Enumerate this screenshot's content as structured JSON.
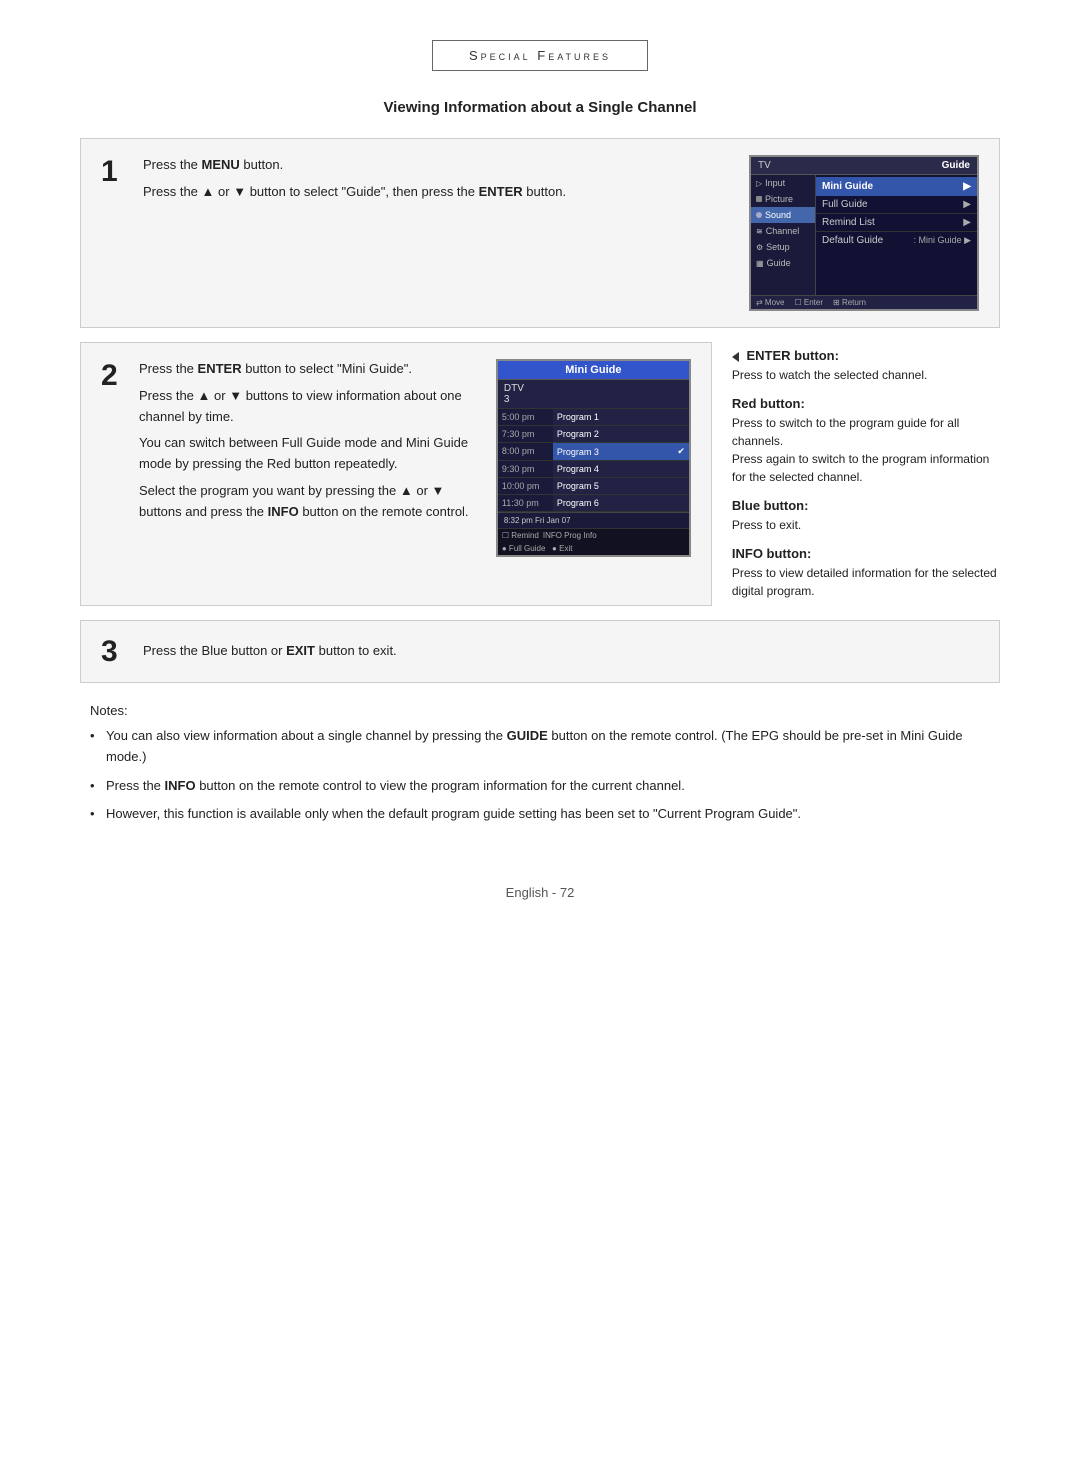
{
  "page": {
    "title": "Special Features",
    "footer": "English - 72"
  },
  "heading": {
    "text": "Viewing Information about a Single Channel"
  },
  "steps": {
    "step1": {
      "number": "1",
      "line1": "Press the ",
      "line1_bold": "MENU",
      "line1_end": " button.",
      "line2_start": "Press the ",
      "line2_up": "▲",
      "line2_mid": " or ",
      "line2_down": "▼",
      "line2_end": " button to select \"Guide\", then press the ",
      "line2_bold": "ENTER",
      "line2_last": " button."
    },
    "step2": {
      "number": "2",
      "line1": "Press the ",
      "line1_bold": "ENTER",
      "line1_end": " button to select \"Mini Guide\".",
      "line2_start": "Press the ",
      "line2_up": "▲",
      "line2_mid": " or ",
      "line2_down": "▼",
      "line2_end": " buttons to view information about one channel by time.",
      "line3": "You can switch between Full Guide mode and Mini Guide mode by pressing the Red button repeatedly.",
      "line4_start": "Select the program you want by pressing the ",
      "line4_up": "▲",
      "line4_mid": " or ",
      "line4_down": "▼",
      "line4_end": " buttons and press the ",
      "line4_bold": "INFO",
      "line4_last": " button on the remote control."
    },
    "step3": {
      "number": "3",
      "text_start": "Press the Blue button or ",
      "text_bold": "EXIT",
      "text_end": " button to exit."
    }
  },
  "tv_menu": {
    "left_label": "TV",
    "right_label": "Guide",
    "menu_items": [
      {
        "label": "Input",
        "active": false
      },
      {
        "label": "Picture",
        "active": false
      },
      {
        "label": "Sound",
        "active": true
      },
      {
        "label": "Channel",
        "active": false
      },
      {
        "label": "Setup",
        "active": false
      },
      {
        "label": "Guide",
        "active": false
      }
    ],
    "guide_items": [
      {
        "label": "Mini Guide",
        "value": "",
        "arrow": "▶",
        "highlighted": true
      },
      {
        "label": "Full Guide",
        "value": "",
        "arrow": "▶"
      },
      {
        "label": "Remind List",
        "value": "",
        "arrow": "▶"
      },
      {
        "label": "Default Guide",
        "value": ": Mini Guide",
        "arrow": "▶"
      }
    ],
    "bottom": "⇄ Move  ☐ Enter  ⊞ Return"
  },
  "mini_guide": {
    "title": "Mini Guide",
    "channel": "DTV\n3",
    "rows": [
      {
        "time": "5:00 pm",
        "program": "Program 1",
        "current": false
      },
      {
        "time": "7:30 pm",
        "program": "Program 2",
        "current": false
      },
      {
        "time": "8:00 pm",
        "program": "Program 3",
        "current": true,
        "check": "✔"
      },
      {
        "time": "9:30 pm",
        "program": "Program 4",
        "current": false
      },
      {
        "time": "10:00 pm",
        "program": "Program 5",
        "current": false
      },
      {
        "time": "11:30 pm",
        "program": "Program 6",
        "current": false
      }
    ],
    "footer_time": "8:32 pm Fri Jan 07",
    "bottom": "☐ Remind  INFO Prog Info\n● Full Guide  ● Exit"
  },
  "side_notes": {
    "enter": {
      "symbol": "◄",
      "title": "ENTER button:",
      "text": "Press to watch the selected channel."
    },
    "red": {
      "title": "Red button:",
      "text": "Press to switch to the program guide for all channels.\nPress again to switch to the program information for the selected channel."
    },
    "blue": {
      "title": "Blue button:",
      "text": "Press to exit."
    },
    "info": {
      "title": "INFO button:",
      "text": "Press to view detailed information for the selected digital program."
    }
  },
  "notes": {
    "title": "Notes:",
    "items": [
      "You can also view information about a single channel by pressing the GUIDE button on the remote control. (The EPG should be pre-set in Mini Guide mode.)",
      "Press the INFO button on the remote control to view the program information for the current channel.",
      "However, this function is available only when the default program guide setting has been set to \"Current Program Guide\"."
    ]
  }
}
